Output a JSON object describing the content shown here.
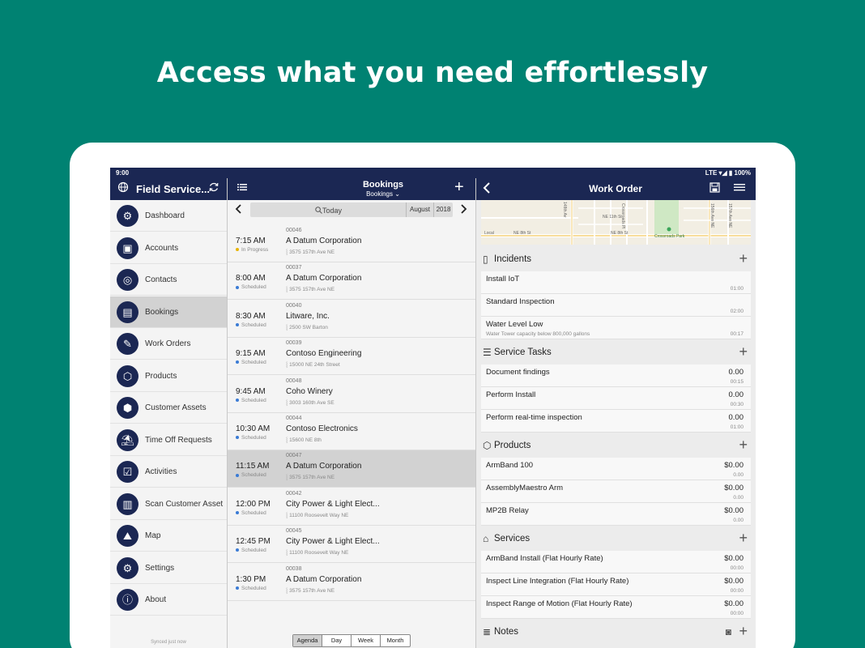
{
  "headline": "Access what you need effortlessly",
  "status_bar": {
    "time": "9:00",
    "indicators": "LTE ▾◢ ▮ 100%"
  },
  "sidebar": {
    "title": "Field Service...",
    "synced": "Synced just now",
    "items": [
      {
        "label": "Dashboard",
        "icon": "dashboard-icon",
        "glyph": "⚙"
      },
      {
        "label": "Accounts",
        "icon": "accounts-icon",
        "glyph": "▣"
      },
      {
        "label": "Contacts",
        "icon": "contacts-icon",
        "glyph": "◎"
      },
      {
        "label": "Bookings",
        "icon": "bookings-icon",
        "glyph": "▤",
        "active": true
      },
      {
        "label": "Work Orders",
        "icon": "work-orders-icon",
        "glyph": "✎"
      },
      {
        "label": "Products",
        "icon": "products-icon",
        "glyph": "⬡"
      },
      {
        "label": "Customer Assets",
        "icon": "customer-assets-icon",
        "glyph": "⬢"
      },
      {
        "label": "Time Off Requests",
        "icon": "time-off-icon",
        "glyph": "⛱"
      },
      {
        "label": "Activities",
        "icon": "activities-icon",
        "glyph": "☑"
      },
      {
        "label": "Scan Customer Asset",
        "icon": "barcode-scan-icon",
        "glyph": "▥"
      },
      {
        "label": "Map",
        "icon": "map-icon",
        "glyph": "⛰"
      },
      {
        "label": "Settings",
        "icon": "settings-icon",
        "glyph": "⚙"
      },
      {
        "label": "About",
        "icon": "info-icon",
        "glyph": "ⓘ"
      }
    ]
  },
  "bookings": {
    "title": "Bookings",
    "subtitle": "Bookings ⌄",
    "today": "Today",
    "month": "August",
    "year": "2018",
    "rows": [
      {
        "time": "7:15 AM",
        "status": "In Progress",
        "status_color": "#e8b400",
        "number": "00046",
        "account": "A Datum Corporation",
        "address": "3575 157th Ave NE"
      },
      {
        "time": "8:00 AM",
        "status": "Scheduled",
        "status_color": "#3a7bd5",
        "number": "00037",
        "account": "A Datum Corporation",
        "address": "3575 157th Ave NE"
      },
      {
        "time": "8:30 AM",
        "status": "Scheduled",
        "status_color": "#3a7bd5",
        "number": "00040",
        "account": "Litware, Inc.",
        "address": "2500 SW Barton"
      },
      {
        "time": "9:15 AM",
        "status": "Scheduled",
        "status_color": "#3a7bd5",
        "number": "00039",
        "account": "Contoso Engineering",
        "address": "15000 NE 24th Street"
      },
      {
        "time": "9:45 AM",
        "status": "Scheduled",
        "status_color": "#3a7bd5",
        "number": "00048",
        "account": "Coho Winery",
        "address": "3003 160th Ave SE"
      },
      {
        "time": "10:30 AM",
        "status": "Scheduled",
        "status_color": "#3a7bd5",
        "number": "00044",
        "account": "Contoso Electronics",
        "address": "15600 NE 8th"
      },
      {
        "time": "11:15 AM",
        "status": "Scheduled",
        "status_color": "#3a7bd5",
        "number": "00047",
        "account": "A Datum Corporation",
        "address": "3575 157th Ave NE",
        "selected": true
      },
      {
        "time": "12:00 PM",
        "status": "Scheduled",
        "status_color": "#3a7bd5",
        "number": "00042",
        "account": "City Power & Light Elect...",
        "address": "11100 Roosevelt Way NE"
      },
      {
        "time": "12:45 PM",
        "status": "Scheduled",
        "status_color": "#3a7bd5",
        "number": "00045",
        "account": "City Power & Light Elect...",
        "address": "11100 Roosevelt Way NE"
      },
      {
        "time": "1:30 PM",
        "status": "Scheduled",
        "status_color": "#3a7bd5",
        "number": "00038",
        "account": "A Datum Corporation",
        "address": "3575 157th Ave NE"
      }
    ],
    "view_tabs": [
      "Agenda",
      "Day",
      "Week",
      "Month"
    ],
    "active_view": "Agenda"
  },
  "work_order": {
    "title": "Work Order",
    "map_labels": [
      "148th Av",
      "NE 11th St",
      "Crossroads Pl",
      "Local",
      "NE 8th St",
      "NE 8th St",
      "Crossroads Park",
      "156th Ave NE",
      "157th Ave NE"
    ],
    "sections": [
      {
        "title": "Incidents",
        "icon": "clipboard-icon",
        "glyph": "▯",
        "rows": [
          {
            "label": "Install IoT",
            "desc": "",
            "value": "",
            "dur": "01:00"
          },
          {
            "label": "Standard Inspection",
            "desc": "",
            "value": "",
            "dur": "02:00"
          },
          {
            "label": "Water Level Low",
            "desc": "Water Tower capacity below 800,000 gallons",
            "value": "",
            "dur": "00:17"
          }
        ]
      },
      {
        "title": "Service Tasks",
        "icon": "checklist-icon",
        "glyph": "☰",
        "rows": [
          {
            "label": "Document findings",
            "desc": "",
            "value": "0.00",
            "dur": "00:15"
          },
          {
            "label": "Perform Install",
            "desc": "",
            "value": "0.00",
            "dur": "00:30"
          },
          {
            "label": "Perform real-time inspection",
            "desc": "",
            "value": "0.00",
            "dur": "01:00"
          }
        ]
      },
      {
        "title": "Products",
        "icon": "box-icon",
        "glyph": "⬡",
        "rows": [
          {
            "label": "ArmBand 100",
            "desc": "",
            "value": "$0.00",
            "dur": "0.00"
          },
          {
            "label": "AssemblyMaestro Arm",
            "desc": "",
            "value": "$0.00",
            "dur": "0.00"
          },
          {
            "label": "MP2B Relay",
            "desc": "",
            "value": "$0.00",
            "dur": "0.00"
          }
        ]
      },
      {
        "title": "Services",
        "icon": "service-bell-icon",
        "glyph": "⌂",
        "rows": [
          {
            "label": "ArmBand Install (Flat Hourly Rate)",
            "desc": "",
            "value": "$0.00",
            "dur": "00:00"
          },
          {
            "label": "Inspect Line Integration (Flat Hourly Rate)",
            "desc": "",
            "value": "$0.00",
            "dur": "00:00"
          },
          {
            "label": "Inspect Range of Motion (Flat Hourly Rate)",
            "desc": "",
            "value": "$0.00",
            "dur": "00:00"
          }
        ]
      },
      {
        "title": "Notes",
        "icon": "notes-icon",
        "glyph": "≣",
        "rows": []
      }
    ]
  }
}
